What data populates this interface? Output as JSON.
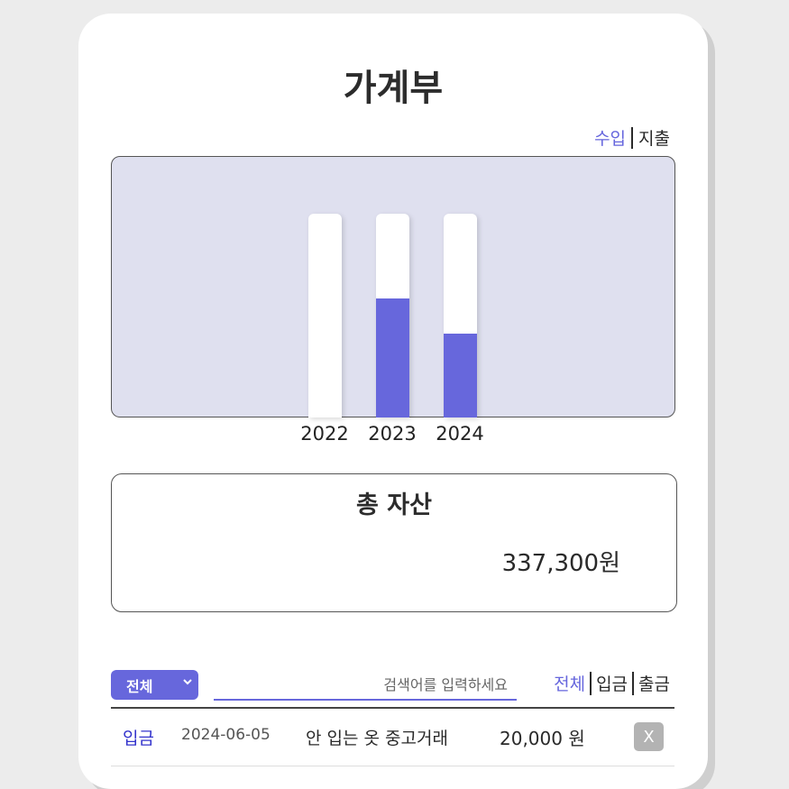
{
  "header": {
    "title": "가계부"
  },
  "chart_toggle": {
    "income": "수입",
    "expense": "지출",
    "active": "income"
  },
  "chart_data": {
    "type": "bar",
    "categories": [
      "2022",
      "2023",
      "2024"
    ],
    "values": [
      0,
      0.585,
      0.41
    ],
    "ylim": [
      0,
      1
    ],
    "title": "",
    "xlabel": "",
    "ylabel": "",
    "colors": {
      "fill": "#6767dc",
      "track": "#ffffff",
      "background": "#dfe0ef"
    }
  },
  "asset": {
    "title": "총 자산",
    "amount": "337,300원"
  },
  "filter": {
    "select_value": "전체",
    "search_placeholder": "검색어를 입력하세요",
    "types": [
      "전체",
      "입금",
      "출금"
    ],
    "active_type": "전체"
  },
  "transactions": [
    {
      "type": "입금",
      "date": "2024-06-05",
      "description": "안 입는 옷 중고거래",
      "amount": "20,000 원",
      "delete_label": "X"
    }
  ],
  "colors": {
    "accent": "#6767dc",
    "income": "#3333cc"
  }
}
